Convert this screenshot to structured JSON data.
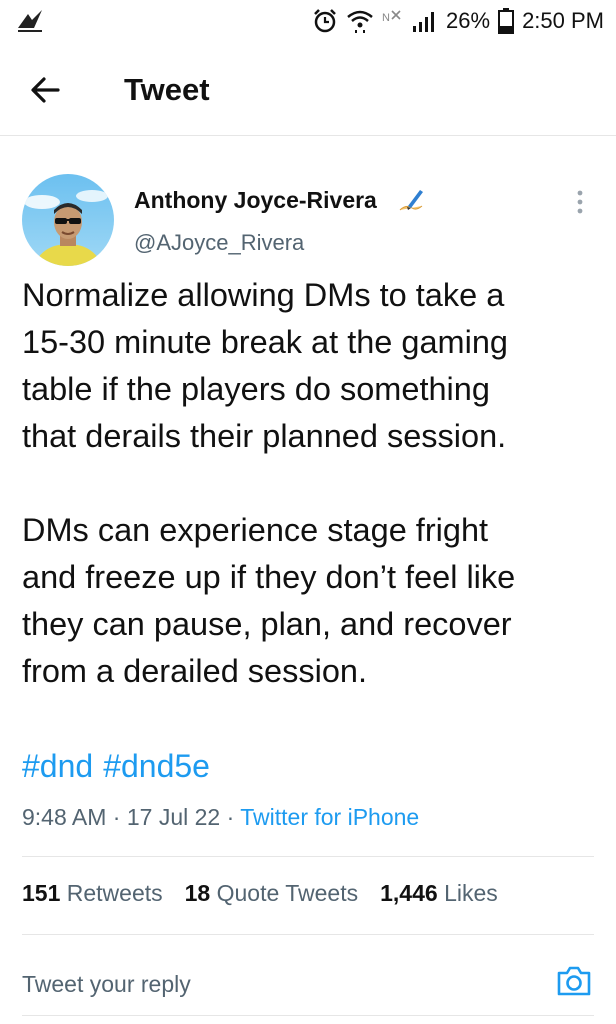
{
  "status_bar": {
    "battery": "26%",
    "time": "2:50 PM"
  },
  "header": {
    "title": "Tweet"
  },
  "tweet": {
    "author_name": "Anthony Joyce-Rivera",
    "author_handle": "@AJoyce_Rivera",
    "paragraphs": [
      "Normalize allowing DMs to take a\n15-30 minute break at the gaming\ntable if the players do something\nthat derails their planned session.",
      "DMs can experience stage fright\nand freeze up if they don’t feel like\nthey can pause, plan, and recover\nfrom a derailed session."
    ],
    "hashtags": [
      "#dnd",
      "#dnd5e"
    ],
    "time": "9:48 AM",
    "date": "17 Jul 22",
    "source": "Twitter for iPhone",
    "separator": "·"
  },
  "stats": {
    "retweets_count": "151",
    "retweets_label": "Retweets",
    "quotes_count": "18",
    "quotes_label": "Quote Tweets",
    "likes_count": "1,446",
    "likes_label": "Likes"
  },
  "reply": {
    "placeholder": "Tweet your reply"
  },
  "colors": {
    "accent": "#1d9bf0",
    "secondary_text": "#536471",
    "primary_text": "#111111"
  }
}
